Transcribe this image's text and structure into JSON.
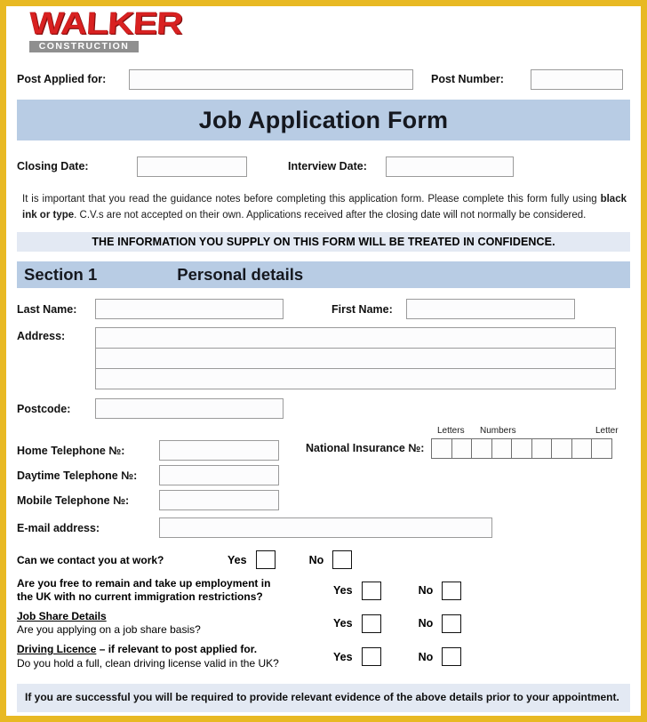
{
  "brand": {
    "name": "WALKER",
    "subtitle": "CONSTRUCTION",
    "primary_color": "#d92121",
    "subtitle_bg": "#8f8f8f"
  },
  "theme": {
    "page_border": "#e8b923",
    "banner_blue": "#b8cce4",
    "note_blue": "#e3e9f3"
  },
  "header": {
    "post_applied_label": "Post Applied for:",
    "post_applied_value": "",
    "post_number_label": "Post Number:",
    "post_number_value": "",
    "title": "Job Application Form"
  },
  "dates": {
    "closing_label": "Closing Date:",
    "closing_value": "",
    "interview_label": "Interview Date:",
    "interview_value": ""
  },
  "instructions": {
    "part1": "It is important that you read the guidance notes before completing this application form. Please complete this form fully using ",
    "emphasis": "black ink or type",
    "part2": ". C.V.s are not accepted on their own. Applications received after the closing date will not normally be considered.",
    "confidence_banner": "THE INFORMATION YOU SUPPLY ON THIS FORM WILL BE TREATED IN CONFIDENCE."
  },
  "section1": {
    "number": "Section 1",
    "name": "Personal details",
    "last_name_label": "Last Name:",
    "last_name_value": "",
    "first_name_label": "First Name:",
    "first_name_value": "",
    "address_label": "Address:",
    "address_line1": "",
    "address_line2": "",
    "address_line3": "",
    "postcode_label": "Postcode:",
    "postcode_value": "",
    "home_phone_label": "Home Telephone №:",
    "home_phone_value": "",
    "daytime_phone_label": "Daytime Telephone №:",
    "daytime_phone_value": "",
    "mobile_phone_label": "Mobile Telephone №:",
    "mobile_phone_value": "",
    "email_label": "E-mail address:",
    "email_value": "",
    "ni_label": "National Insurance №:",
    "ni_head_letters": "Letters",
    "ni_head_numbers": "Numbers",
    "ni_head_letter": "Letter",
    "ni_box_count": 9
  },
  "questions": {
    "yes_label": "Yes",
    "no_label": "No",
    "contact_at_work": "Can we contact you at work?",
    "free_to_remain_line1": "Are you free to remain and take up employment in",
    "free_to_remain_line2": "the UK with no current immigration restrictions?",
    "job_share_heading": "Job Share Details",
    "job_share_question": "Are you applying on a job share basis?",
    "driving_heading": "Driving Licence",
    "driving_heading_rest": " – if relevant to post applied for.",
    "driving_question": "Do you hold a full, clean driving license valid in the UK?"
  },
  "footer": {
    "note": "If you are successful you will be required to provide relevant evidence of the above details prior to your appointment."
  }
}
